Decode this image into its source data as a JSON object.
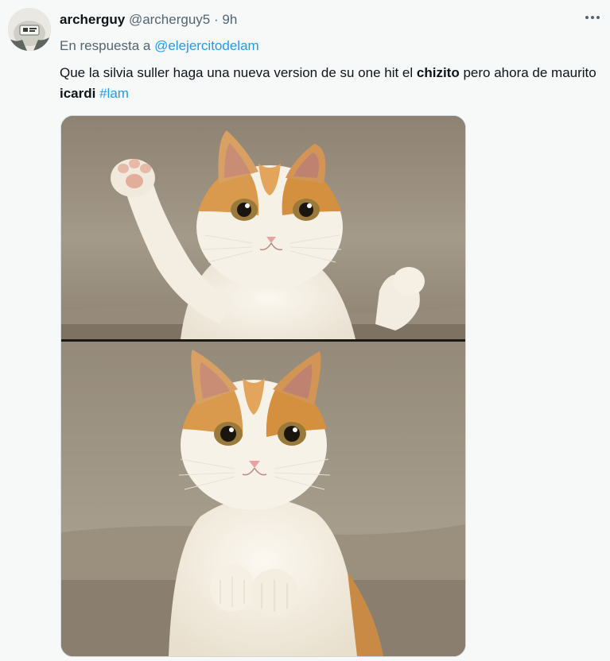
{
  "user": {
    "display_name": "archerguy",
    "handle": "@archerguy5",
    "separator": "·",
    "time": "9h"
  },
  "reply": {
    "prefix": "En respuesta a",
    "mention": "@elejercitodelam"
  },
  "text": {
    "part1": "Que la silvia suller haga una nueva version de su one hit el ",
    "bold1": "chizito",
    "part2": " pero ahora de maurito ",
    "bold2": "icardi",
    "hashtag": "#lam"
  },
  "icons": {
    "more": "more-horizontal-icon"
  },
  "colors": {
    "link": "#1d9bf0",
    "secondary_text": "#536471",
    "background": "#f7f9f9"
  }
}
